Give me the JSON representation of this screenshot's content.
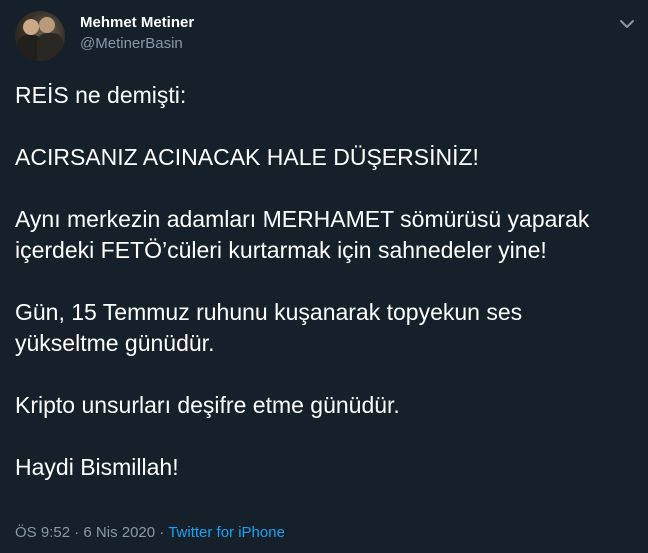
{
  "author": {
    "name": "Mehmet Metiner",
    "handle": "@MetinerBasin"
  },
  "icons": {
    "menu": "chevron-down-icon",
    "avatar": "profile-avatar"
  },
  "tweet": {
    "paragraphs": [
      "REİS ne demişti:",
      "ACIRSANIZ ACINACAK HALE DÜŞERSİNİZ!",
      "Aynı merkezin adamları MERHAMET sömürüsü yaparak\niçerdeki FETÖ’cüleri kurtarmak için sahnedeler yine!",
      "Gün, 15 Temmuz ruhunu kuşanarak topyekun ses\nyükseltme günüdür.",
      "Kripto unsurları deşifre etme günüdür.",
      "Haydi Bismillah!"
    ]
  },
  "meta": {
    "time": "ÖS 9:52",
    "separator": "·",
    "date": "6 Nis 2020",
    "source": "Twitter for iPhone"
  },
  "colors": {
    "background": "#15202b",
    "text": "#ffffff",
    "muted": "#8899a6",
    "accent": "#1da1f2"
  }
}
